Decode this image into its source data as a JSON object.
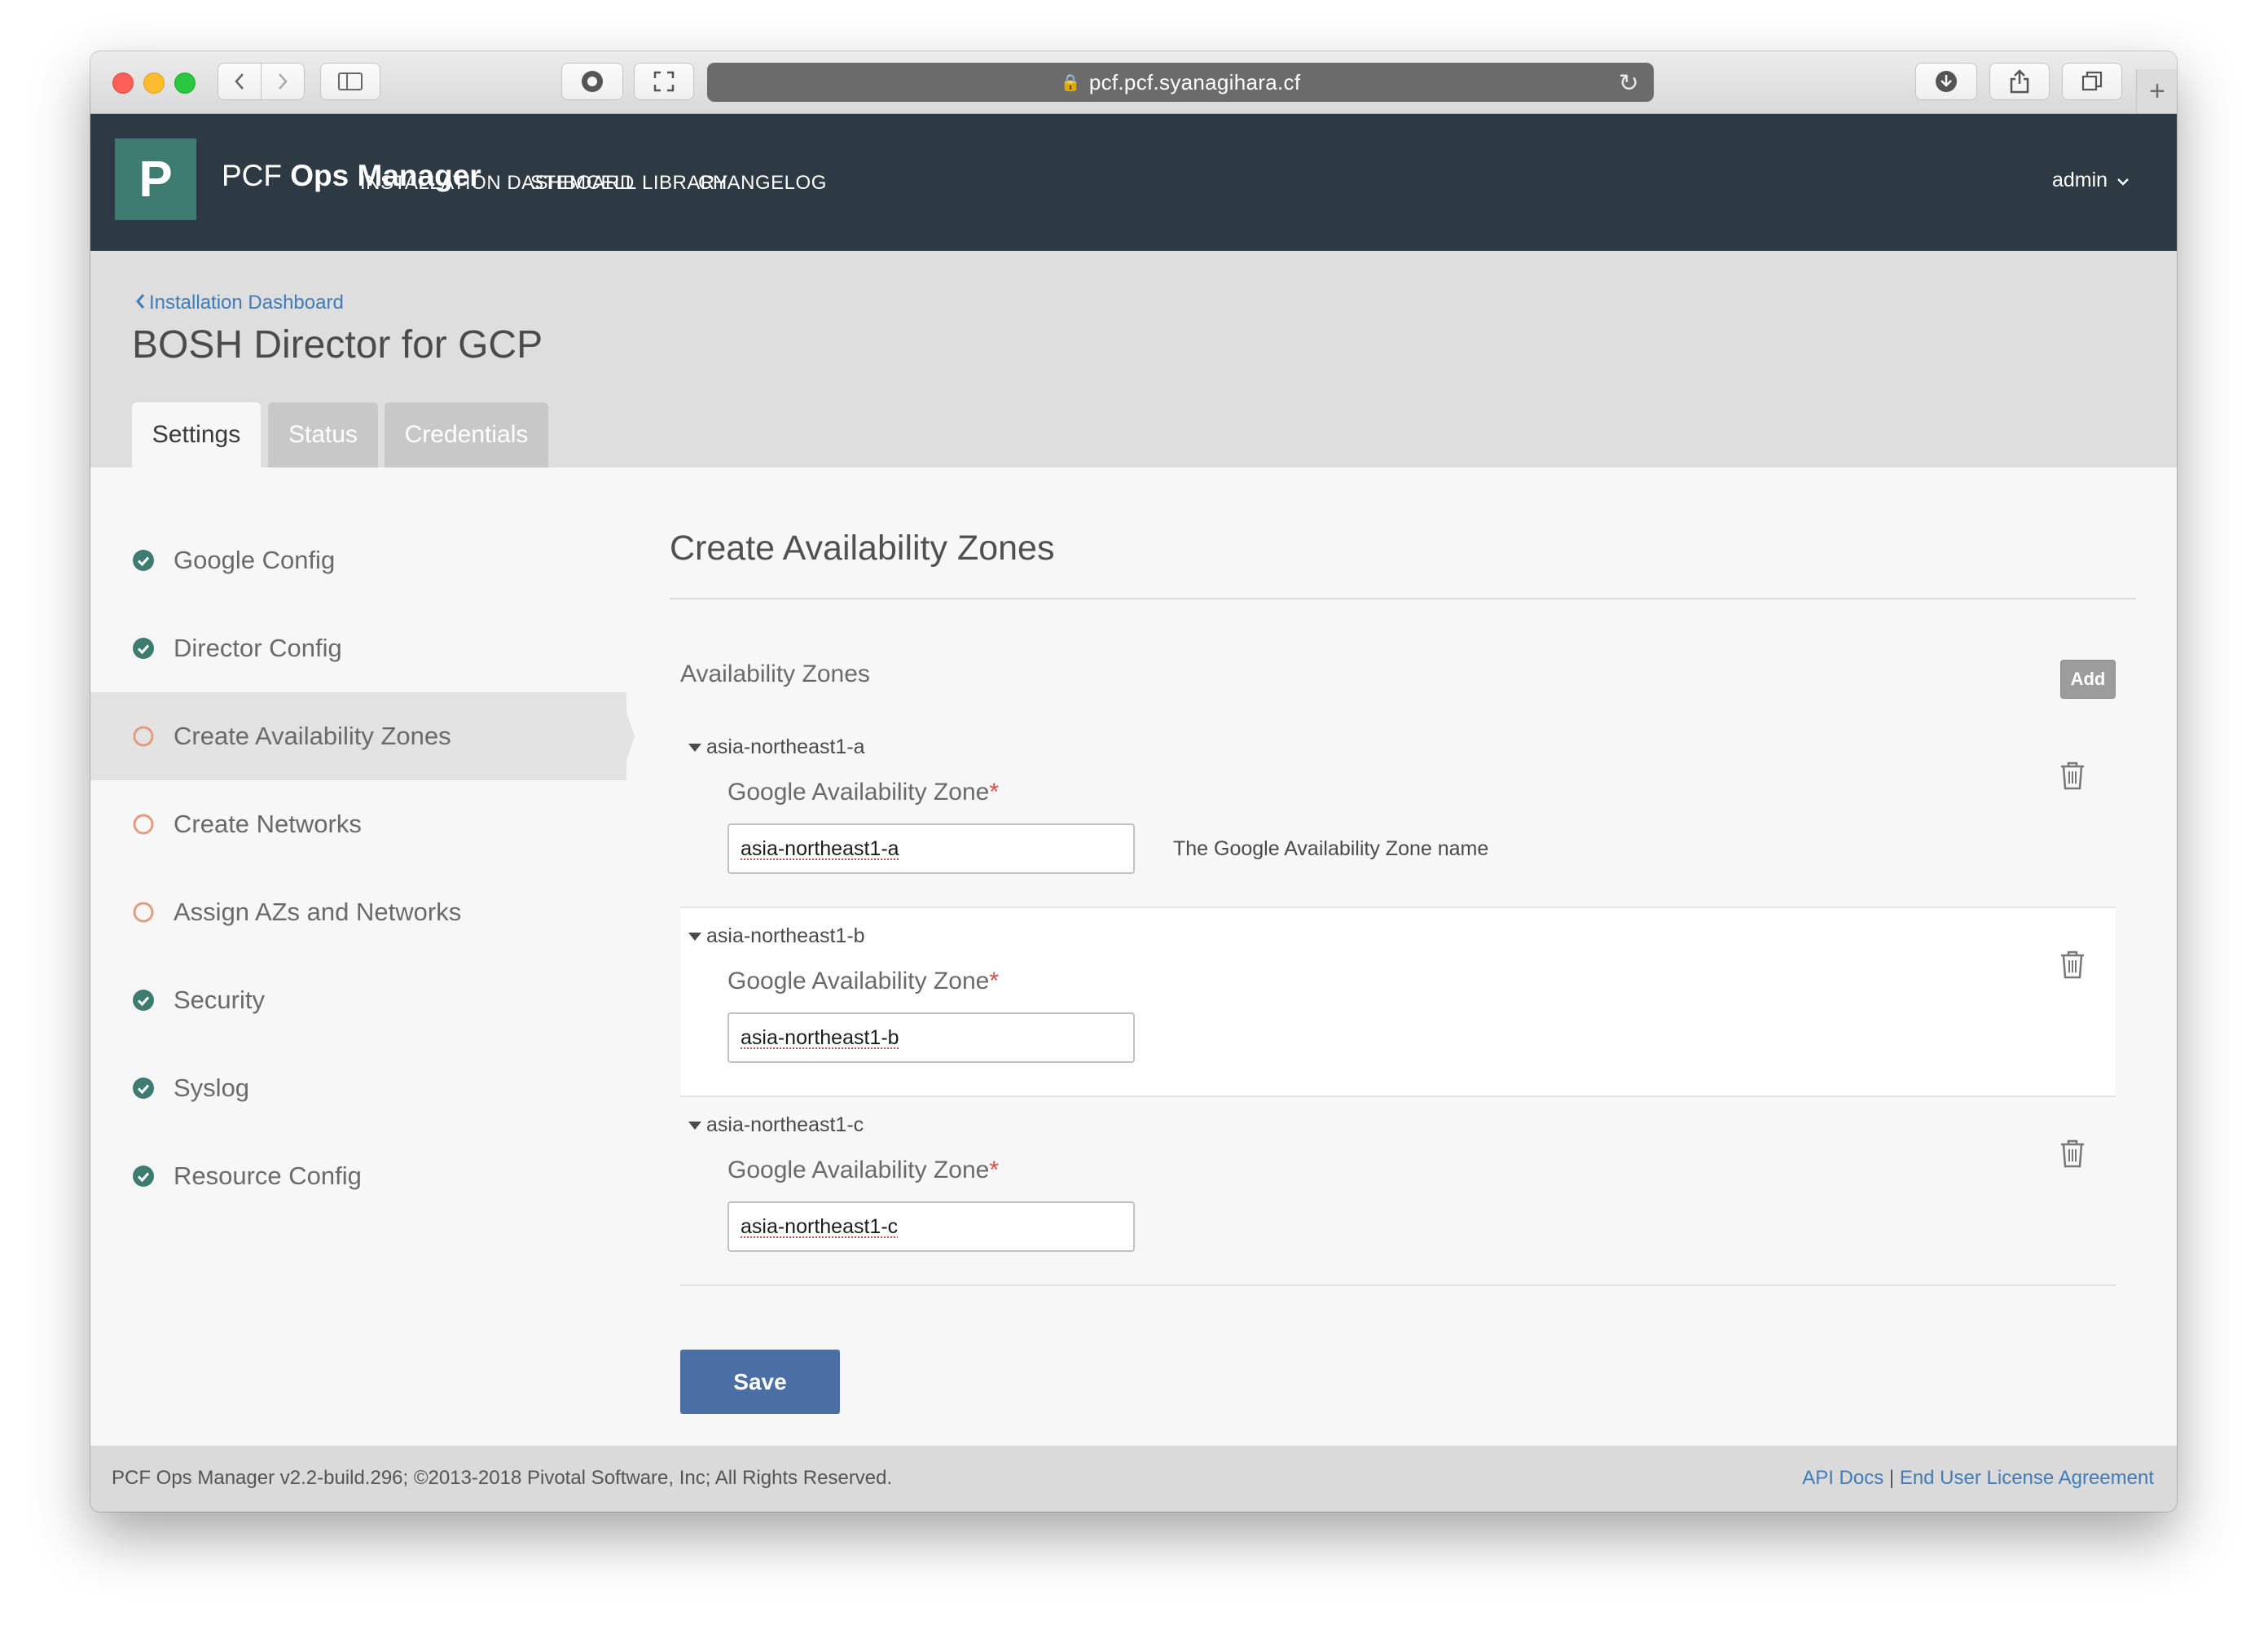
{
  "browser": {
    "url": "pcf.pcf.syanagihara.cf"
  },
  "header": {
    "logo_letter": "P",
    "brand_prefix": "PCF",
    "brand_name": "Ops Manager",
    "nav": [
      "INSTALLATION DASHBOARD",
      "STEMCELL LIBRARY",
      "CHANGELOG"
    ],
    "user": "admin"
  },
  "breadcrumb": "Installation Dashboard",
  "page_title": "BOSH Director for GCP",
  "tabs": [
    "Settings",
    "Status",
    "Credentials"
  ],
  "sidebar": {
    "items": [
      {
        "label": "Google Config",
        "status": "complete"
      },
      {
        "label": "Director Config",
        "status": "complete"
      },
      {
        "label": "Create Availability Zones",
        "status": "incomplete"
      },
      {
        "label": "Create Networks",
        "status": "incomplete"
      },
      {
        "label": "Assign AZs and Networks",
        "status": "incomplete"
      },
      {
        "label": "Security",
        "status": "complete"
      },
      {
        "label": "Syslog",
        "status": "complete"
      },
      {
        "label": "Resource Config",
        "status": "complete"
      }
    ]
  },
  "main": {
    "section_title": "Create Availability Zones",
    "zones_label": "Availability Zones",
    "add_label": "Add",
    "zones": [
      {
        "name": "asia-northeast1-a",
        "field_label": "Google Availability Zone",
        "required_mark": "*",
        "value": "asia-northeast1-a",
        "hint": "The Google Availability Zone name"
      },
      {
        "name": "asia-northeast1-b",
        "field_label": "Google Availability Zone",
        "required_mark": "*",
        "value": "asia-northeast1-b",
        "hint": ""
      },
      {
        "name": "asia-northeast1-c",
        "field_label": "Google Availability Zone",
        "required_mark": "*",
        "value": "asia-northeast1-c",
        "hint": ""
      }
    ],
    "save_label": "Save"
  },
  "footer": {
    "copyright": "PCF Ops Manager v2.2-build.296; ©2013-2018 Pivotal Software, Inc; All Rights Reserved.",
    "api_docs": "API Docs",
    "separator": "|",
    "eula": "End User License Agreement"
  },
  "colors": {
    "header_bg": "#2d3943",
    "logo_bg": "#3e7c72",
    "complete_icon": "#3e7c72",
    "incomplete_icon": "#e39c7e",
    "link": "#3f7cb8",
    "save_button": "#4a6fa5",
    "required": "#d0544b"
  }
}
